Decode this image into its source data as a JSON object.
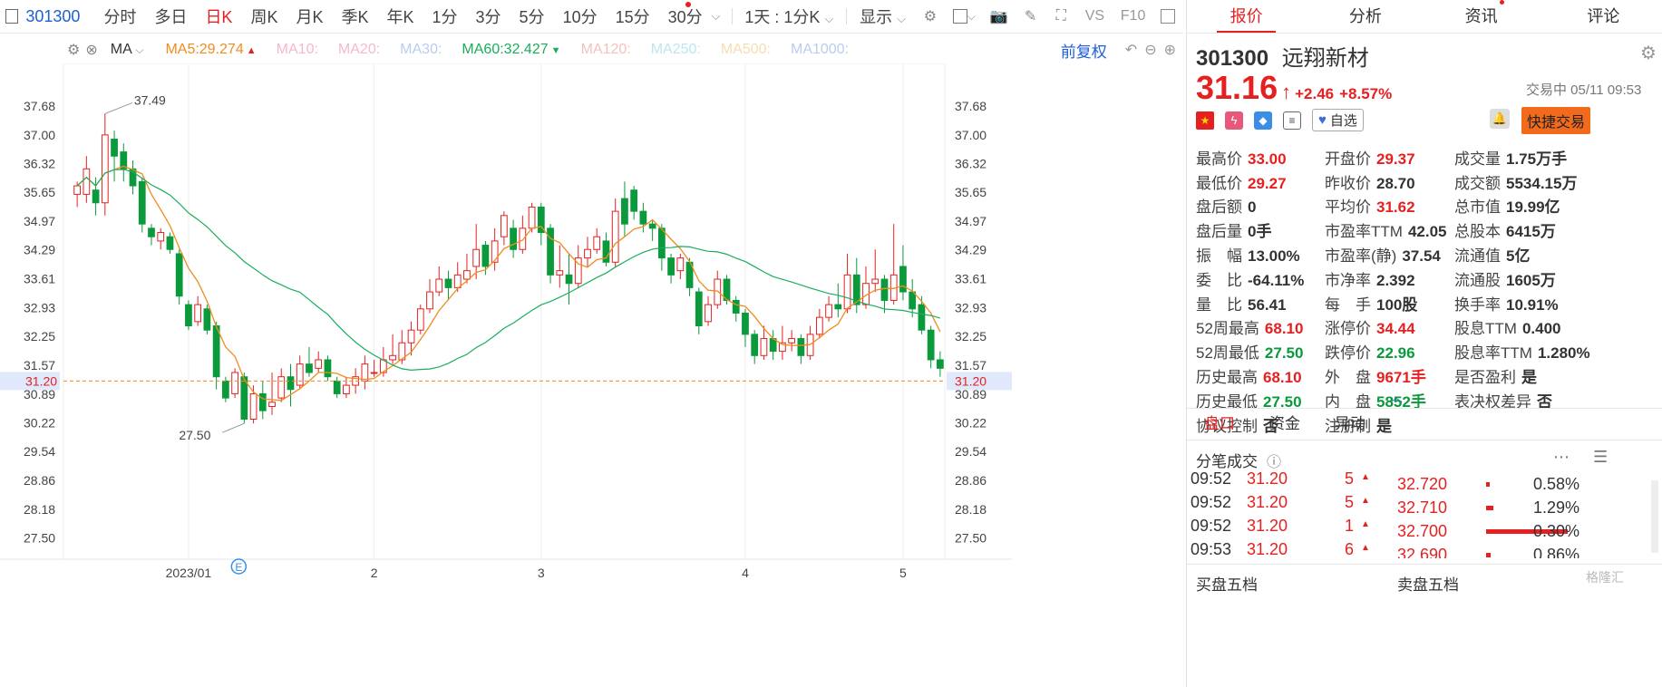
{
  "toolbar": {
    "code": "301300",
    "items": [
      "分时",
      "多日",
      "日K",
      "周K",
      "月K",
      "季K",
      "年K",
      "1分",
      "3分",
      "5分",
      "10分",
      "15分",
      "30分"
    ],
    "active": "日K",
    "period_select": "1天 : 1分K",
    "display_select": "显示",
    "vs_label": "VS",
    "f10_label": "F10"
  },
  "ma_row": {
    "main_indicator": "MA",
    "items": [
      {
        "name": "MA5:",
        "value": "29.274",
        "color": "#f08c1e",
        "arrow": "▲",
        "arrow_color": "#e62020"
      },
      {
        "name": "MA10:",
        "value": "",
        "color": "#f7b7cf"
      },
      {
        "name": "MA20:",
        "value": "",
        "color": "#f7b7cf"
      },
      {
        "name": "MA30:",
        "value": "",
        "color": "#b9cdef"
      },
      {
        "name": "MA60:",
        "value": "32.427",
        "color": "#1aae5c",
        "arrow": "▼",
        "arrow_color": "#1aae5c"
      },
      {
        "name": "MA120:",
        "value": "",
        "color": "#f7c0c0"
      },
      {
        "name": "MA250:",
        "value": "",
        "color": "#bde6f0"
      },
      {
        "name": "MA500:",
        "value": "",
        "color": "#f7ddb0"
      },
      {
        "name": "MA1000:",
        "value": "",
        "color": "#b9cdef"
      }
    ],
    "adjust_button": "前复权"
  },
  "chart_data": {
    "type": "candlestick",
    "y_ticks": [
      "37.68",
      "37.00",
      "36.32",
      "35.65",
      "34.97",
      "34.29",
      "33.61",
      "32.93",
      "32.25",
      "31.57",
      "30.89",
      "30.22",
      "29.54",
      "28.86",
      "28.18",
      "27.50"
    ],
    "ylim": [
      27.0,
      38.3
    ],
    "x_labels": [
      {
        "label": "2023/01",
        "index": 12
      },
      {
        "label": "2",
        "index": 32
      },
      {
        "label": "3",
        "index": 50
      },
      {
        "label": "4",
        "index": 72
      },
      {
        "label": "5",
        "index": 89
      }
    ],
    "current_price_label": "31.20",
    "current_price": 31.2,
    "high_marker": "37.49",
    "low_marker": "27.50",
    "event_marker": "E",
    "candles": [
      [
        35.6,
        35.8,
        35.3,
        35.9
      ],
      [
        35.6,
        36.2,
        35.4,
        36.5
      ],
      [
        35.7,
        35.4,
        35.1,
        36.0
      ],
      [
        35.4,
        37.0,
        35.1,
        37.5
      ],
      [
        36.9,
        36.5,
        35.9,
        37.1
      ],
      [
        36.6,
        36.2,
        35.9,
        36.8
      ],
      [
        36.2,
        35.8,
        35.6,
        36.4
      ],
      [
        35.9,
        34.9,
        34.7,
        36.0
      ],
      [
        34.8,
        34.6,
        34.4,
        34.9
      ],
      [
        34.5,
        34.7,
        34.3,
        34.8
      ],
      [
        34.6,
        34.3,
        34.2,
        34.7
      ],
      [
        34.2,
        33.2,
        33.0,
        34.3
      ],
      [
        33.0,
        32.5,
        32.4,
        33.1
      ],
      [
        32.6,
        33.0,
        32.5,
        33.2
      ],
      [
        32.9,
        32.4,
        32.3,
        33.0
      ],
      [
        32.5,
        31.3,
        31.0,
        32.6
      ],
      [
        31.2,
        30.8,
        30.7,
        31.3
      ],
      [
        30.9,
        31.4,
        30.8,
        31.5
      ],
      [
        31.3,
        30.3,
        30.2,
        31.4
      ],
      [
        30.3,
        30.9,
        30.2,
        31.1
      ],
      [
        30.9,
        30.5,
        30.3,
        31.2
      ],
      [
        30.6,
        30.7,
        30.4,
        31.4
      ],
      [
        30.8,
        31.3,
        30.7,
        31.5
      ],
      [
        31.3,
        31.0,
        30.6,
        31.6
      ],
      [
        31.1,
        31.6,
        31.0,
        31.8
      ],
      [
        31.6,
        31.4,
        31.3,
        32.0
      ],
      [
        31.5,
        31.7,
        31.4,
        31.9
      ],
      [
        31.7,
        31.3,
        31.2,
        31.8
      ],
      [
        31.2,
        30.9,
        30.8,
        31.3
      ],
      [
        30.9,
        31.1,
        30.8,
        31.3
      ],
      [
        31.1,
        31.3,
        30.9,
        31.5
      ],
      [
        31.2,
        31.6,
        31.0,
        31.8
      ],
      [
        31.4,
        31.4,
        31.3,
        31.7
      ],
      [
        31.4,
        31.7,
        31.3,
        32.0
      ],
      [
        31.7,
        31.8,
        31.6,
        32.3
      ],
      [
        31.7,
        32.1,
        31.6,
        32.4
      ],
      [
        32.1,
        32.4,
        31.8,
        32.6
      ],
      [
        32.4,
        32.9,
        32.3,
        33.0
      ],
      [
        32.9,
        33.3,
        32.8,
        33.6
      ],
      [
        33.3,
        33.6,
        33.2,
        33.9
      ],
      [
        33.6,
        33.4,
        33.1,
        33.8
      ],
      [
        33.4,
        33.7,
        33.3,
        34.0
      ],
      [
        33.6,
        33.8,
        33.5,
        34.2
      ],
      [
        33.9,
        34.3,
        33.6,
        34.9
      ],
      [
        34.4,
        33.9,
        33.7,
        34.5
      ],
      [
        34.0,
        34.5,
        33.8,
        34.8
      ],
      [
        34.6,
        35.1,
        34.4,
        35.2
      ],
      [
        34.8,
        34.3,
        34.1,
        35.0
      ],
      [
        34.3,
        34.8,
        34.2,
        35.1
      ],
      [
        34.8,
        35.3,
        34.7,
        35.4
      ],
      [
        35.3,
        34.7,
        34.4,
        35.4
      ],
      [
        34.8,
        33.7,
        33.5,
        34.9
      ],
      [
        33.7,
        33.8,
        33.4,
        34.4
      ],
      [
        33.7,
        33.5,
        33.0,
        34.2
      ],
      [
        33.5,
        34.1,
        33.4,
        34.4
      ],
      [
        34.1,
        34.3,
        33.9,
        34.6
      ],
      [
        34.3,
        34.6,
        34.2,
        34.8
      ],
      [
        34.5,
        34.0,
        33.9,
        34.7
      ],
      [
        34.0,
        35.2,
        33.9,
        35.5
      ],
      [
        35.5,
        34.9,
        34.6,
        35.9
      ],
      [
        35.7,
        35.2,
        35.0,
        35.8
      ],
      [
        35.2,
        34.9,
        34.7,
        35.4
      ],
      [
        34.9,
        34.8,
        34.5,
        35.0
      ],
      [
        34.8,
        34.1,
        33.8,
        34.9
      ],
      [
        34.1,
        33.7,
        33.5,
        34.2
      ],
      [
        33.8,
        34.1,
        33.6,
        34.2
      ],
      [
        34.0,
        33.4,
        33.2,
        34.1
      ],
      [
        33.3,
        32.5,
        32.3,
        33.4
      ],
      [
        32.6,
        33.0,
        32.5,
        33.2
      ],
      [
        33.0,
        33.6,
        32.9,
        33.8
      ],
      [
        33.6,
        33.1,
        33.0,
        33.7
      ],
      [
        33.1,
        32.8,
        32.6,
        33.2
      ],
      [
        32.8,
        32.3,
        32.0,
        32.9
      ],
      [
        32.3,
        31.8,
        31.6,
        32.4
      ],
      [
        31.8,
        32.2,
        31.7,
        32.5
      ],
      [
        32.2,
        31.9,
        31.7,
        32.4
      ],
      [
        31.9,
        32.1,
        31.7,
        32.5
      ],
      [
        32.1,
        32.2,
        31.9,
        32.4
      ],
      [
        32.2,
        31.8,
        31.6,
        32.3
      ],
      [
        31.8,
        32.3,
        31.7,
        32.5
      ],
      [
        32.3,
        32.7,
        32.2,
        32.9
      ],
      [
        32.7,
        33.0,
        32.6,
        33.2
      ],
      [
        33.0,
        32.9,
        32.7,
        33.5
      ],
      [
        32.9,
        33.7,
        32.8,
        34.2
      ],
      [
        33.7,
        33.0,
        32.8,
        34.1
      ],
      [
        33.0,
        33.5,
        32.9,
        33.9
      ],
      [
        33.5,
        33.6,
        33.3,
        34.3
      ],
      [
        33.6,
        33.1,
        32.8,
        33.7
      ],
      [
        33.1,
        33.7,
        33.0,
        34.9
      ],
      [
        33.9,
        33.3,
        33.1,
        34.4
      ],
      [
        33.3,
        32.9,
        32.7,
        33.6
      ],
      [
        33.0,
        32.4,
        32.3,
        33.2
      ],
      [
        32.4,
        31.7,
        31.5,
        32.5
      ],
      [
        31.7,
        31.5,
        31.3,
        31.9
      ]
    ]
  },
  "panel": {
    "tabs": [
      {
        "label": "报价",
        "active": true
      },
      {
        "label": "分析"
      },
      {
        "label": "资讯",
        "dot": true
      },
      {
        "label": "评论"
      }
    ],
    "stock_code": "301300",
    "stock_name": "远翔新材",
    "price": "31.16",
    "change": "+2.46",
    "change_pct": "+8.57%",
    "trade_status": "交易中 05/11 09:53",
    "watch_button": "自选",
    "quick_trade": "快捷交易",
    "quote_rows": [
      [
        [
          "最高价",
          "33.00",
          "red"
        ],
        [
          "开盘价",
          "29.37",
          "red"
        ],
        [
          "成交量",
          "1.75万手",
          ""
        ]
      ],
      [
        [
          "最低价",
          "29.27",
          "red"
        ],
        [
          "昨收价",
          "28.70",
          ""
        ],
        [
          "成交额",
          "5534.15万",
          ""
        ]
      ],
      [
        [
          "盘后额",
          "0",
          ""
        ],
        [
          "平均价",
          "31.62",
          "red"
        ],
        [
          "总市值",
          "19.99亿",
          ""
        ]
      ],
      [
        [
          "盘后量",
          "0手",
          ""
        ],
        [
          "市盈率TTM",
          "42.05",
          ""
        ],
        [
          "总股本",
          "6415万",
          ""
        ]
      ],
      [
        [
          "振　幅",
          "13.00%",
          ""
        ],
        [
          "市盈率(静)",
          "37.54",
          ""
        ],
        [
          "流通值",
          "5亿",
          ""
        ]
      ],
      [
        [
          "委　比",
          "-64.11%",
          ""
        ],
        [
          "市净率",
          "2.392",
          ""
        ],
        [
          "流通股",
          "1605万",
          ""
        ]
      ],
      [
        [
          "量　比",
          "56.41",
          ""
        ],
        [
          "每　手",
          "100股",
          ""
        ],
        [
          "换手率",
          "10.91%",
          ""
        ]
      ],
      [
        [
          "52周最高",
          "68.10",
          "red"
        ],
        [
          "涨停价",
          "34.44",
          "red"
        ],
        [
          "股息TTM",
          "0.400",
          ""
        ]
      ],
      [
        [
          "52周最低",
          "27.50",
          "green"
        ],
        [
          "跌停价",
          "22.96",
          "green"
        ],
        [
          "股息率TTM",
          "1.280%",
          ""
        ]
      ],
      [
        [
          "历史最高",
          "68.10",
          "red"
        ],
        [
          "外　盘",
          "9671手",
          "red"
        ],
        [
          "是否盈利",
          "是",
          ""
        ]
      ],
      [
        [
          "历史最低",
          "27.50",
          "green"
        ],
        [
          "内　盘",
          "5852手",
          "green"
        ],
        [
          "表决权差异",
          "否",
          ""
        ]
      ],
      [
        [
          "协议控制",
          "否",
          ""
        ],
        [
          "注册制",
          "是",
          ""
        ],
        [
          "",
          "",
          " "
        ]
      ]
    ],
    "sub_tabs": [
      {
        "label": "盘口",
        "active": true
      },
      {
        "label": "资金"
      },
      {
        "label": "异动"
      }
    ],
    "ticks_title": "分笔成交",
    "ticks": [
      {
        "time": "09:52",
        "price": "31.20",
        "vol": "5"
      },
      {
        "time": "09:52",
        "price": "31.20",
        "vol": "5"
      },
      {
        "time": "09:52",
        "price": "31.20",
        "vol": "1"
      },
      {
        "time": "09:53",
        "price": "31.20",
        "vol": "6"
      }
    ],
    "depth": [
      {
        "price": "32.720",
        "pct": "0.58%",
        "bar": 0.04
      },
      {
        "price": "32.710",
        "pct": "1.29%",
        "bar": 0.08
      },
      {
        "price": "32.700",
        "pct": "0.30%",
        "bar": 0.9
      },
      {
        "price": "32.690",
        "pct": "0.86%",
        "bar": 0.05
      }
    ],
    "buy_five": "买盘五档",
    "sell_five": "卖盘五档",
    "watermark": "格隆汇"
  }
}
